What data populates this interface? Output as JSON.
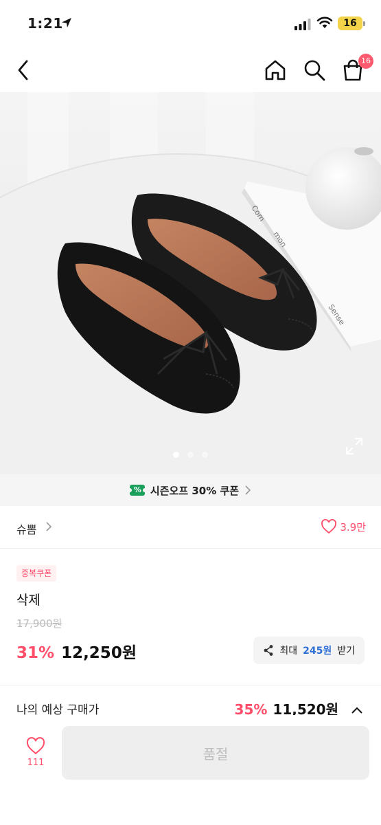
{
  "status_bar": {
    "time": "1:21",
    "battery": "16"
  },
  "nav": {
    "cart_badge": "16"
  },
  "gallery": {
    "image_text": [
      "Com",
      "mon",
      "Sense"
    ],
    "total_images": 3,
    "active_index": 0
  },
  "coupon_banner": {
    "icon_text": "%",
    "text": "시즌오프 30% 쿠폰"
  },
  "brand": {
    "name": "슈뽐",
    "like_count": "3.9만"
  },
  "product": {
    "coupon_tag": "중복쿠폰",
    "title": "삭제",
    "original_price": "17,900원",
    "discount_rate": "31%",
    "sale_price": "12,250원",
    "point_prefix": "최대",
    "point_amount": "245원",
    "point_suffix": "받기"
  },
  "expected": {
    "label": "나의 예상 구매가",
    "discount_rate": "35%",
    "price": "11,520원"
  },
  "bottom_bar": {
    "wish_count": "111",
    "soldout_label": "품절"
  },
  "colors": {
    "accent": "#ff4d6a",
    "point_blue": "#2f6fd6",
    "coupon_green": "#1aa05a",
    "battery": "#f2d34a"
  },
  "icons": [
    "location-arrow-icon",
    "signal-icon",
    "wifi-icon",
    "back-icon",
    "home-icon",
    "search-icon",
    "cart-icon",
    "expand-icon",
    "coupon-icon",
    "chevron-right-icon",
    "heart-icon",
    "share-icon",
    "chevron-up-icon"
  ]
}
